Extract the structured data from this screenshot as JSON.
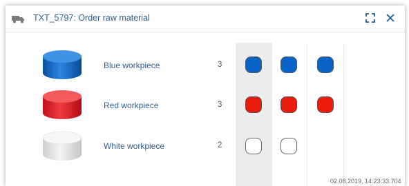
{
  "window": {
    "title": "TXT_5797: Order raw material",
    "icons": {
      "title_icon": "truck-icon",
      "expand": "expand-icon",
      "close": "close-icon"
    }
  },
  "rows": [
    {
      "label": "Blue workpiece",
      "count": "3",
      "color": "#0a64c8",
      "filled": 3
    },
    {
      "label": "Red workpiece",
      "count": "3",
      "color": "#ea1c0c",
      "filled": 3
    },
    {
      "label": "White workpiece",
      "count": "2",
      "color": "#ffffff",
      "filled": 2
    }
  ],
  "timestamp": "02.08.2019, 14:23:33.704",
  "colors": {
    "accent": "#2f5f8a"
  }
}
